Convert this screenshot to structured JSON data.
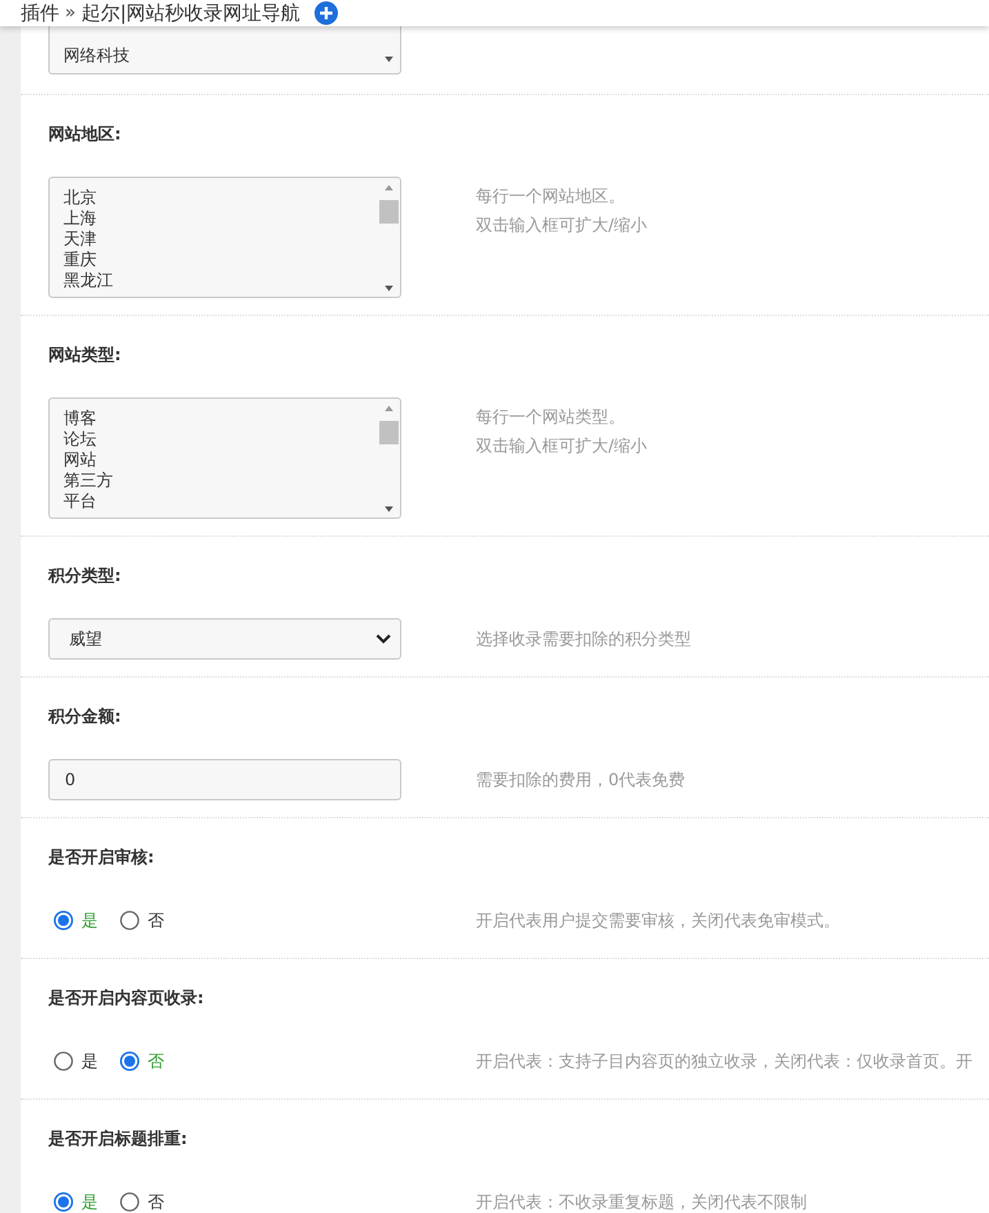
{
  "header": {
    "breadcrumb": [
      "插件",
      "起尔|网站秒收录网址导航"
    ],
    "separator": "»"
  },
  "settings": [
    {
      "kind": "list",
      "lines": [
        "网络科技"
      ]
    },
    {
      "kind": "list",
      "label": "网站地区:",
      "lines": [
        "北京",
        "上海",
        "天津",
        "重庆",
        "黑龙江"
      ],
      "hint": [
        "每行一个网站地区。",
        "双击输入框可扩大/缩小"
      ]
    },
    {
      "kind": "list",
      "label": "网站类型:",
      "lines": [
        "博客",
        "论坛",
        "网站",
        "第三方",
        "平台"
      ],
      "hint": [
        "每行一个网站类型。",
        "双击输入框可扩大/缩小"
      ]
    },
    {
      "kind": "select",
      "label": "积分类型:",
      "value": "威望",
      "hint": [
        "选择收录需要扣除的积分类型"
      ]
    },
    {
      "kind": "text",
      "label": "积分金额:",
      "value": "0",
      "hint": [
        "需要扣除的费用，0代表免费"
      ]
    },
    {
      "kind": "radio",
      "label": "是否开启审核:",
      "options": [
        {
          "label": "是",
          "selected": true
        },
        {
          "label": "否",
          "selected": false
        }
      ],
      "hint": [
        "开启代表用户提交需要审核，关闭代表免审模式。"
      ]
    },
    {
      "kind": "radio",
      "label": "是否开启内容页收录:",
      "options": [
        {
          "label": "是",
          "selected": false
        },
        {
          "label": "否",
          "selected": true
        }
      ],
      "hint": [
        "开启代表：支持子目内容页的独立收录，关闭代表：仅收录首页。开"
      ]
    },
    {
      "kind": "radio",
      "label": "是否开启标题排重:",
      "options": [
        {
          "label": "是",
          "selected": true
        },
        {
          "label": "否",
          "selected": false
        }
      ],
      "hint": [
        "开启代表：不收录重复标题，关闭代表不限制"
      ]
    }
  ]
}
